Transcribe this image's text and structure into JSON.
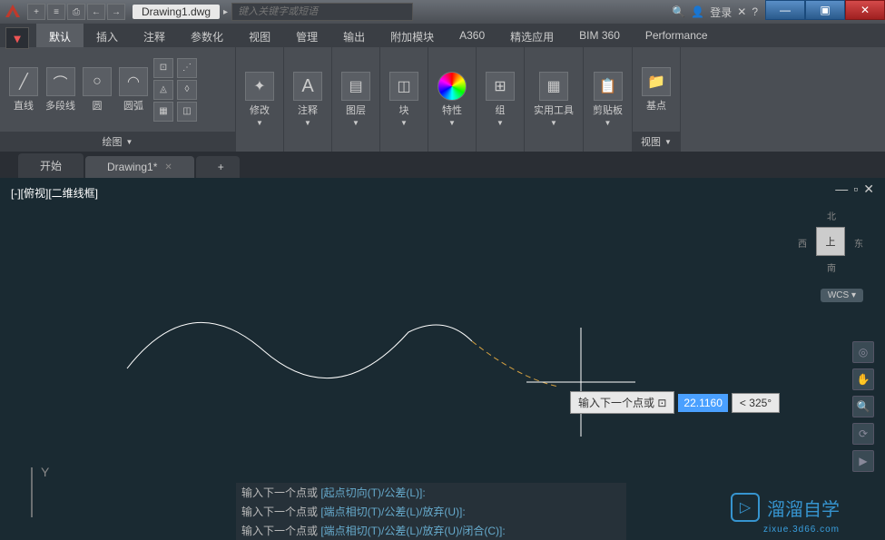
{
  "titlebar": {
    "app_name": "A",
    "document_title": "Drawing1.dwg",
    "search_placeholder": "键入关键字或短语",
    "login_label": "登录",
    "qat": [
      "+",
      "≡",
      "⎙",
      "←",
      "→"
    ]
  },
  "window_controls": {
    "minimize": "—",
    "maximize": "▣",
    "close": "✕"
  },
  "menu_tabs": [
    "默认",
    "插入",
    "注释",
    "参数化",
    "视图",
    "管理",
    "输出",
    "附加模块",
    "A360",
    "精选应用",
    "BIM 360",
    "Performance"
  ],
  "active_menu_tab": 0,
  "ribbon": {
    "panels": [
      {
        "title": "绘图",
        "tools": [
          {
            "label": "直线",
            "icon": "╱"
          },
          {
            "label": "多段线",
            "icon": "⌒"
          },
          {
            "label": "圆",
            "icon": "○"
          },
          {
            "label": "圆弧",
            "icon": "◠"
          }
        ]
      },
      {
        "title": "",
        "tools": [
          {
            "label": "修改",
            "icon": "✦"
          }
        ]
      },
      {
        "title": "",
        "tools": [
          {
            "label": "注释",
            "icon": "A"
          }
        ]
      },
      {
        "title": "",
        "tools": [
          {
            "label": "图层",
            "icon": "▤"
          }
        ]
      },
      {
        "title": "",
        "tools": [
          {
            "label": "块",
            "icon": "◫"
          }
        ]
      },
      {
        "title": "",
        "tools": [
          {
            "label": "特性",
            "icon": "◉"
          }
        ]
      },
      {
        "title": "",
        "tools": [
          {
            "label": "组",
            "icon": "⊞"
          }
        ]
      },
      {
        "title": "",
        "tools": [
          {
            "label": "实用工具",
            "icon": "▦"
          }
        ]
      },
      {
        "title": "",
        "tools": [
          {
            "label": "剪贴板",
            "icon": "📋"
          }
        ]
      },
      {
        "title": "视图",
        "tools": [
          {
            "label": "基点",
            "icon": "📁"
          }
        ]
      }
    ]
  },
  "doc_tabs": [
    {
      "label": "开始",
      "active": false
    },
    {
      "label": "Drawing1*",
      "active": true
    }
  ],
  "doc_tab_add": "+",
  "viewport_label": "[-][俯视][二维线框]",
  "viewcube": {
    "face": "上",
    "north": "北",
    "south": "南",
    "east": "东",
    "west": "西",
    "wcs": "WCS"
  },
  "dynamic_input": {
    "prompt": "输入下一个点或",
    "value": "22.1160",
    "angle": "< 325°"
  },
  "ucs_y": "Y",
  "command_history": [
    {
      "prefix": "输入下一个点或 ",
      "options": "[起点切向(T)/公差(L)]:"
    },
    {
      "prefix": "输入下一个点或 ",
      "options": "[端点相切(T)/公差(L)/放弃(U)]:"
    },
    {
      "prefix": "输入下一个点或 ",
      "options": "[端点相切(T)/公差(L)/放弃(U)/闭合(C)]:"
    }
  ],
  "watermark": {
    "text": "溜溜自学",
    "url": "zixue.3d66.com"
  }
}
